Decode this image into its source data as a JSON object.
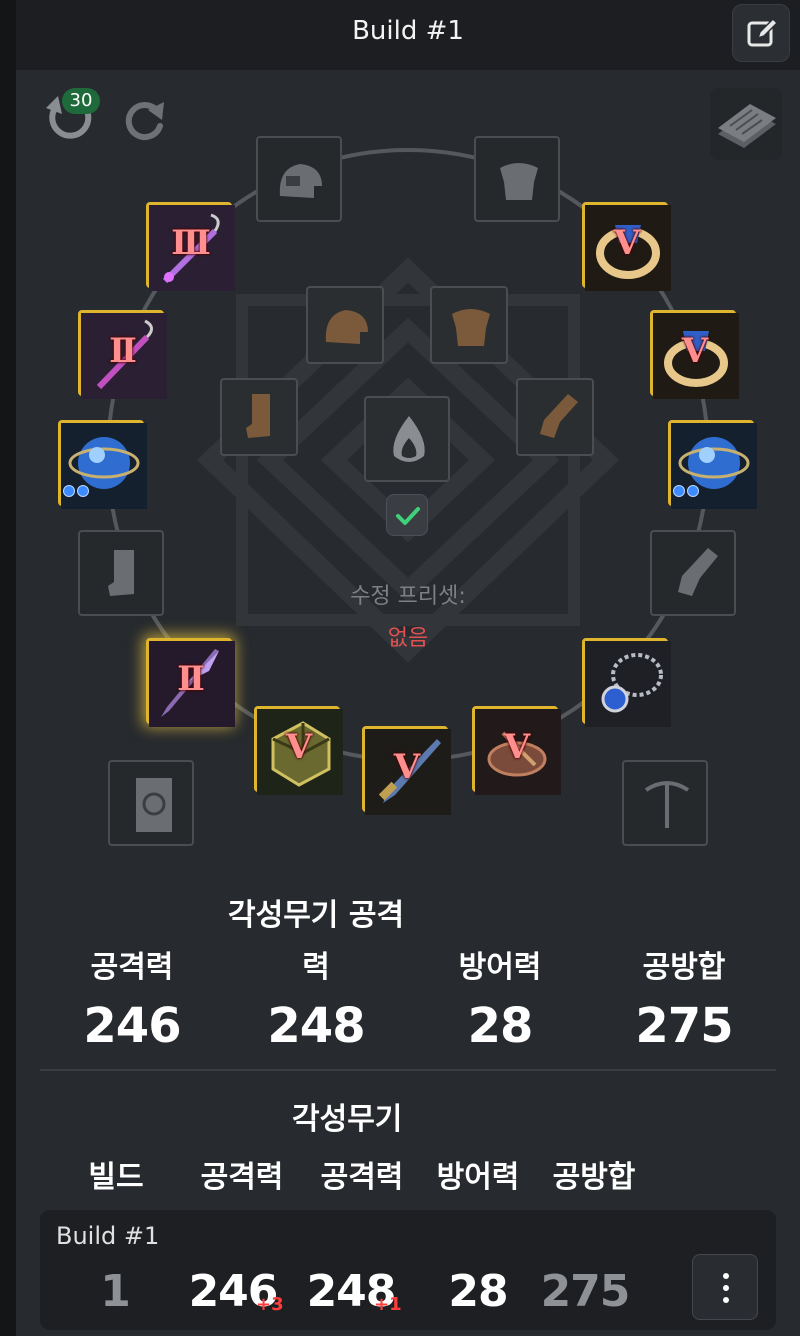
{
  "header": {
    "title": "Build #1",
    "edit_icon": "edit-icon"
  },
  "toolbar": {
    "undo_count": "30",
    "undo_icon": "undo-icon",
    "redo_icon": "redo-icon",
    "notes_icon": "notes-icon"
  },
  "gear": {
    "outer_slots": [
      {
        "name": "slot-helmet",
        "state": "empty",
        "icon": "helmet-icon"
      },
      {
        "name": "slot-armor",
        "state": "empty",
        "icon": "armor-icon"
      },
      {
        "name": "slot-earring-1",
        "state": "equipped",
        "icon": "earring-icon",
        "tier": "III"
      },
      {
        "name": "slot-ring-1",
        "state": "equipped",
        "icon": "ring-icon",
        "tier": "V"
      },
      {
        "name": "slot-earring-2",
        "state": "equipped",
        "icon": "earring-icon",
        "tier": "II"
      },
      {
        "name": "slot-ring-2",
        "state": "equipped",
        "icon": "ring-icon",
        "tier": "V"
      },
      {
        "name": "slot-orb-left",
        "state": "equipped",
        "icon": "orb-icon",
        "dots": 2
      },
      {
        "name": "slot-orb-right",
        "state": "equipped",
        "icon": "orb-icon",
        "dots": 2
      },
      {
        "name": "slot-boots",
        "state": "empty",
        "icon": "boots-icon"
      },
      {
        "name": "slot-gloves",
        "state": "empty",
        "icon": "gloves-icon"
      },
      {
        "name": "slot-awakening-weapon",
        "state": "equipped",
        "icon": "awakening-weapon-icon",
        "tier": "II"
      },
      {
        "name": "slot-necklace",
        "state": "equipped",
        "icon": "necklace-icon"
      },
      {
        "name": "slot-belt",
        "state": "equipped",
        "icon": "belt-icon",
        "tier": "V"
      },
      {
        "name": "slot-main-weapon",
        "state": "equipped",
        "icon": "main-weapon-icon",
        "tier": "V"
      },
      {
        "name": "slot-sub-weapon",
        "state": "equipped",
        "icon": "sub-weapon-icon",
        "tier": "V"
      },
      {
        "name": "slot-artifact",
        "state": "empty",
        "icon": "book-icon"
      },
      {
        "name": "slot-tool",
        "state": "empty",
        "icon": "pickaxe-icon"
      }
    ],
    "inner_slots": [
      {
        "name": "costume-helmet",
        "icon": "helmet-icon"
      },
      {
        "name": "costume-armor",
        "icon": "armor-icon"
      },
      {
        "name": "costume-boots",
        "icon": "boots-icon"
      },
      {
        "name": "costume-gloves",
        "icon": "gloves-icon"
      },
      {
        "name": "crystal-slot",
        "icon": "crystal-icon"
      }
    ],
    "crystal_preset_label": "수정 프리셋:",
    "crystal_preset_value": "없음"
  },
  "stats": {
    "heading": "각성무기 공격",
    "items": [
      {
        "label": "공격력",
        "value": "246"
      },
      {
        "label": "력",
        "value": "248"
      },
      {
        "label": "방어력",
        "value": "28"
      },
      {
        "label": "공방합",
        "value": "275"
      }
    ]
  },
  "table": {
    "group_label": "각성무기",
    "headers": [
      "빌드",
      "공격력",
      "공격력",
      "방어력",
      "공방합"
    ],
    "rows": [
      {
        "name": "Build #1",
        "build": "1",
        "ap": "246",
        "ap_delta": "+3",
        "aap": "248",
        "aap_delta": "+1",
        "dp": "28",
        "gs": "275"
      }
    ],
    "more_icon": "more-vertical-icon"
  },
  "colors": {
    "equipped_border": "#e0b52e",
    "tier_text": "#ff8e8e",
    "preset_value": "#e05050",
    "badge": "#1e6a3b"
  }
}
